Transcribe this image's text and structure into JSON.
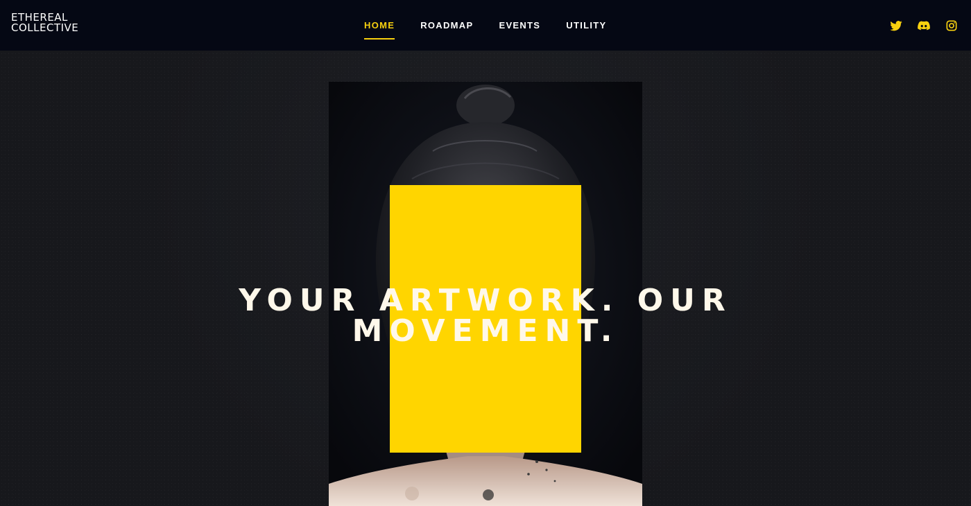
{
  "brand": {
    "line1": "ETHEREAL",
    "line2": "COLLECTIVE"
  },
  "nav": {
    "items": [
      {
        "label": "HOME",
        "active": true
      },
      {
        "label": "ROADMAP",
        "active": false
      },
      {
        "label": "EVENTS",
        "active": false
      },
      {
        "label": "UTILITY",
        "active": false
      }
    ]
  },
  "social": {
    "icons": [
      "twitter-icon",
      "discord-icon",
      "instagram-icon"
    ]
  },
  "hero": {
    "headline_line1": "YOUR ARTWORK. OUR",
    "headline_line2": "MOVEMENT."
  },
  "colors": {
    "accent": "#f8d10f",
    "block": "#ffd500",
    "header_bg": "#050814",
    "page_bg": "#17181c",
    "headline": "#fff8ea"
  }
}
